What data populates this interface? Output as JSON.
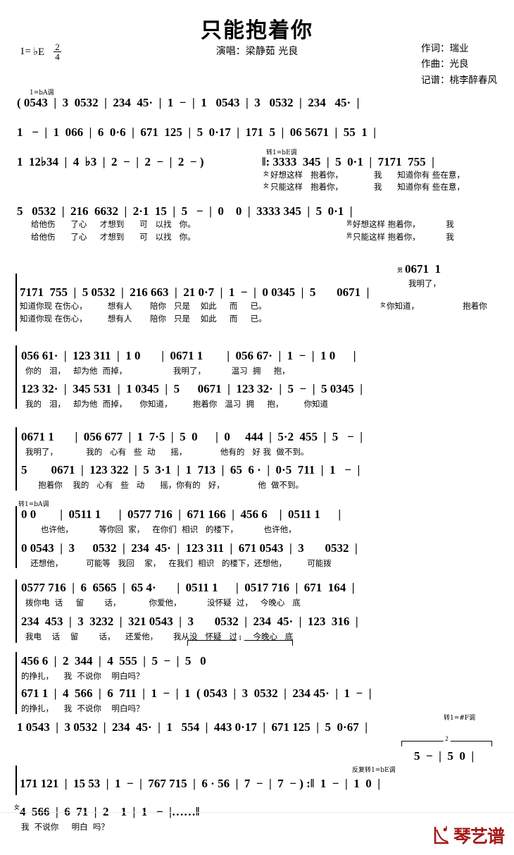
{
  "header": {
    "title": "只能抱着你",
    "performer": "演唱：梁静茹 光良",
    "key": "1=",
    "key_note": "♭E",
    "meter_num": "2",
    "meter_den": "4",
    "credits": [
      "作词：瑞业",
      "作曲：光良",
      "记谱：桃李醉春风"
    ]
  },
  "key_marks": {
    "intro": "1=bA调",
    "mod_bE": "转1=bE调",
    "mod_bA": "转1=bA调",
    "mod_sF": "转1=#F调",
    "repeat_bE": "反复转1=bE调"
  },
  "voice_marks": {
    "female": "女",
    "male": "男"
  },
  "endings": {
    "first": "1",
    "second": "2"
  },
  "systems": [
    {
      "id": "intro-1",
      "music": "( 0543  |  3  0532  |  234  45·  |  1  −  |  1   0543  |  3   0532  |  234   45·  |",
      "lyrics": []
    },
    {
      "id": "intro-2",
      "music": "1   −  |  1  066  |  6  0·6  |  671  125  |  5  0·17  |  171  5  |  06 5671  |  55  1  |",
      "lyrics": []
    },
    {
      "id": "intro-3",
      "music": "1  12♭34  |  4  ♭3  |  2  −  |  2  −  |  2  − )",
      "music2": "‖: 3333  345  |  5  0·1  |  7171  755  |",
      "lyrics": [
        "好想这样   抱着你，            我      知道你有 些在意，",
        "只能这样   抱着你，            我      知道你有 些在意，"
      ]
    },
    {
      "id": "verse-1",
      "music": "5   0532  |  216  6632  |  2·1  15  |  5   −  |  0    0  |  3333 345  |  5  0·1  |",
      "lyrics": [
        "给他伤      了心     才想到      可   以找   你。",
        "给他伤      了心     才想到      可   以找   你。"
      ],
      "lyrics_right": [
        "好想这样 抱着你，          我",
        "只能这样 抱着你，          我"
      ]
    },
    {
      "id": "pickup",
      "music": "0671  1",
      "lyrics": [
        "我明了，"
      ]
    },
    {
      "id": "verse-2",
      "music_top": "7171  755  |  5 0532  |  216 663  |  21 0·7  |  1  −  |  0 0345  |  5       0671  |",
      "lyrics_top": "知道你现 在伤心，        想有人       陪你   只是    如此     而     已。",
      "lyrics_top2": "知道你现 在伤心，        想有人       陪你   只是    如此     而     已。",
      "lyrics_right": "你知道，                 抱着你"
    },
    {
      "id": "chorus-1-a",
      "music": "056 61·  |  123 311  |  1 0       |  0671 1        |  056 67·  |  1  −  |  1 0      |",
      "lyrics": "你的   泪，   却为他  而掉，                  我明了，          温习  拥     抱，"
    },
    {
      "id": "chorus-1-b",
      "music": "123 32·  |  345 531  |  1 0345  |  5      0671  |  123 32·  |  5  −  |  5 0345  |",
      "lyrics": "我的   泪，   却为他  而掉，     你知道，        抱着你   温习  拥     抱，        你知道"
    },
    {
      "id": "chorus-2-a",
      "music": "0671 1       |  056 677  |  1  7·5  |  5  0      |  0     444  |  5·2  455  |  5   −  |",
      "lyrics": "我明了，           我的   心有   些  动      摇，             他有的   好 我  做不到。"
    },
    {
      "id": "chorus-2-b",
      "music": "5        0671  |  123 322  |  5  3·1  |  1  713  |  65  6 ·  |  0·5  711  |  1   −  |",
      "lyrics": "     抱着你    我的   心有   些   动      摇，你有的   好，             他  做不到。"
    },
    {
      "id": "bridge-a",
      "music": "0 0        |  0511 1      |  0577 716  |  671 166  |  456 6    |  0511 1      |",
      "lyrics": "      也许他，          等你回  家，   在你们  相识   的楼下，          也许他，"
    },
    {
      "id": "bridge-b",
      "music": "0 0543  |  3      0532  |  234  45·  |  123 311  |  671 0543  |  3       0532  |",
      "lyrics": "  还想他，         可能等   我回    家，   在我们  相识   的楼下，还想他，        可能拨"
    },
    {
      "id": "bridge2-a",
      "music": "0577 716  |  6  6565  |  65 4·       |  0511 1      |  0517 716  |  671  164  |",
      "lyrics": "拨你电  话     留        话，           你爱他，          没怀疑  过，   今晚心   底"
    },
    {
      "id": "bridge2-b",
      "music": "234  453  |  3  3232  |  321 0543  |  3       0532  |  234  45·  |  123  316  |",
      "lyrics": "我电    话    留        话，    还爱他，      我从没   怀疑   过，   今晚心   底"
    },
    {
      "id": "end-a",
      "music": "456 6  |  2  344  |  4  555  |  5  −  |  5   0",
      "lyrics": "的挣扎，    我  不说你    明白吗？"
    },
    {
      "id": "end-b",
      "music": "671 1  |  4  566  |  6  711  |  1  −  |  1  ( 0543  |  3  0532  |  234 45·  |  1  −  |",
      "lyrics": "的挣扎，    我  不说你    明白吗？"
    },
    {
      "id": "outro-1",
      "music": "1 0543  |  3 0532  |  234  45·  |  1   554  |  443 0·17  |  671 125  |  5  0·67  |"
    },
    {
      "id": "outro-2-high",
      "music": "5  −  |  5  0  |"
    },
    {
      "id": "outro-2",
      "music": "171 121  |  15 53  |  1  −  |  767 715  |  6 · 56  |  7  −  |  7  − ) :‖  1  −  |  1  0  |"
    },
    {
      "id": "coda",
      "music": "4  566  |  6  71  |  2    1  |  1   −  |……‖",
      "lyrics": "我  不说你     明白  吗？"
    }
  ],
  "watermark": {
    "text": "琴艺谱",
    "color": "#a51818"
  }
}
